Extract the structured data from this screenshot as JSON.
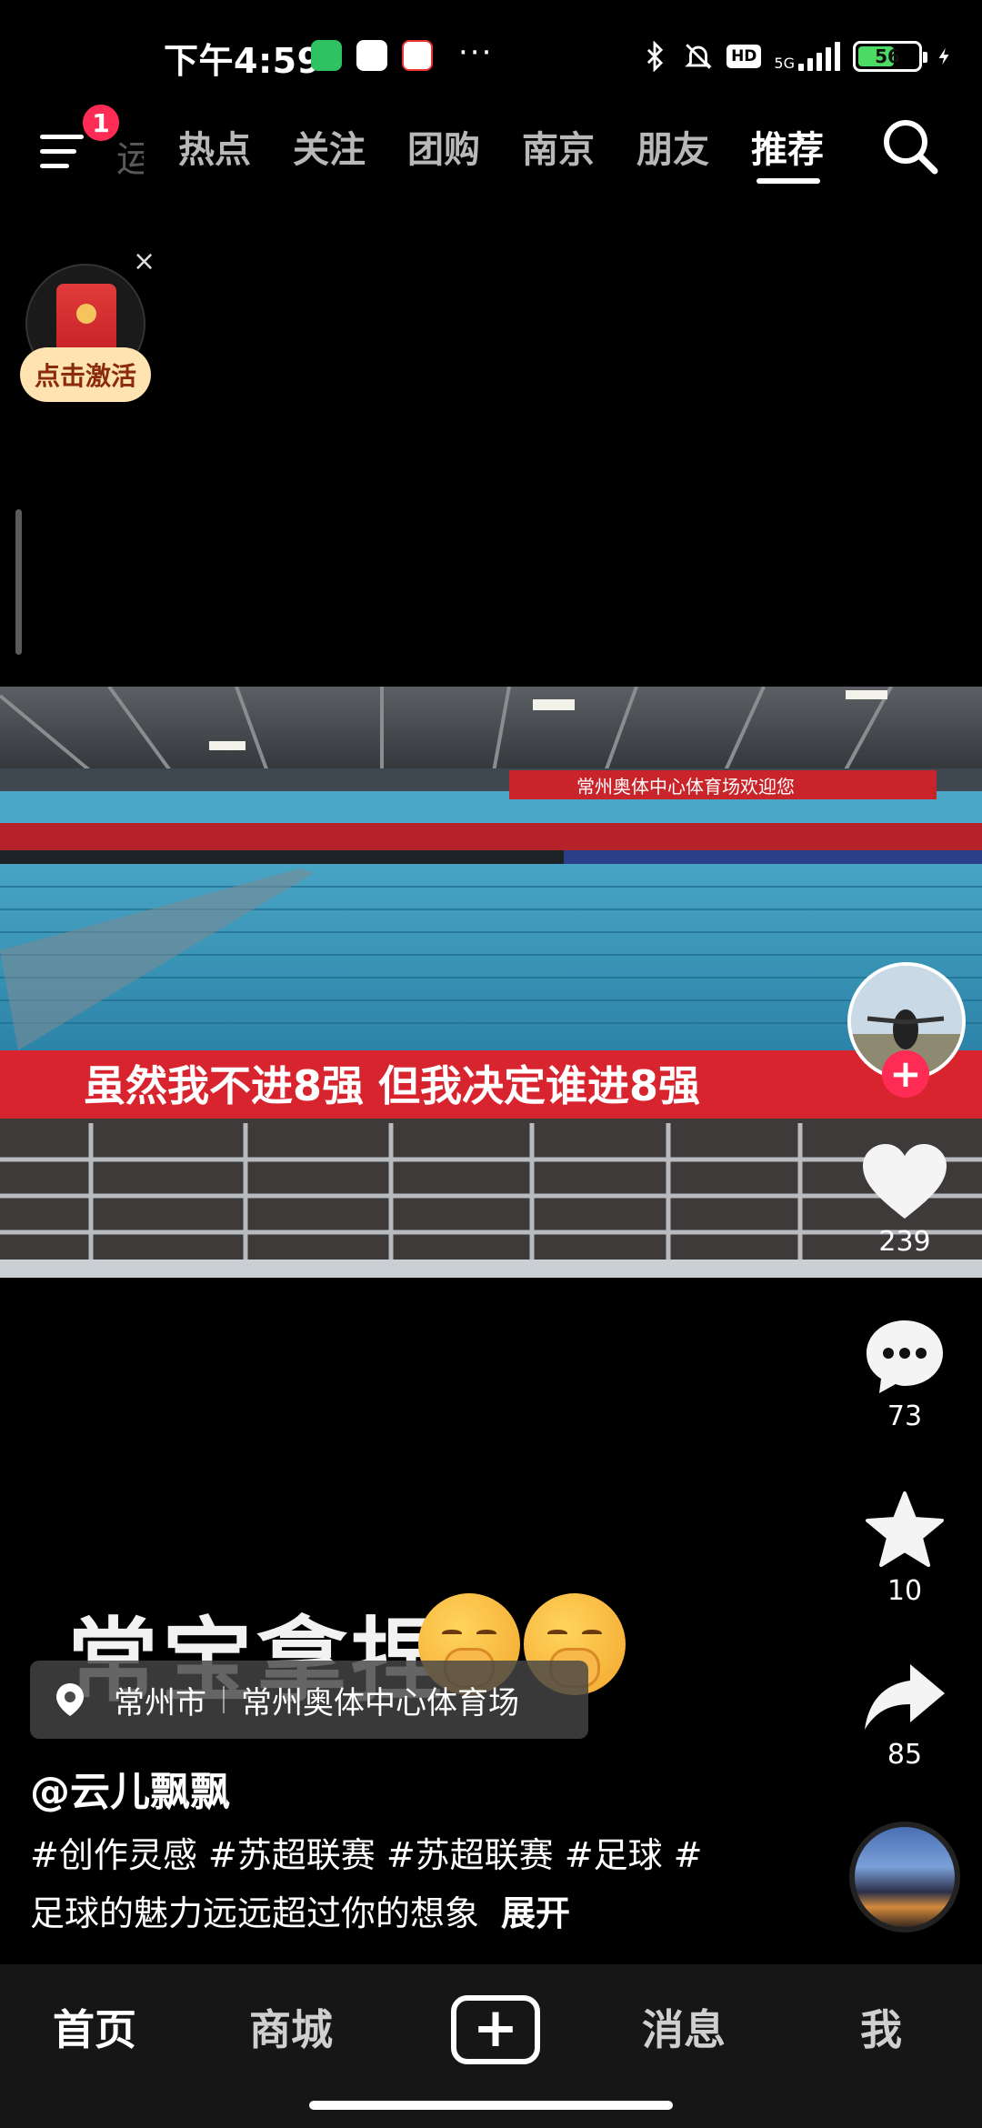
{
  "status_bar": {
    "time": "下午4:59",
    "dots": "···",
    "hd": "HD",
    "network": "5G",
    "battery": "56"
  },
  "top_nav": {
    "partial_tab": "运",
    "tabs": [
      "热点",
      "关注",
      "团购",
      "南京",
      "朋友",
      "推荐"
    ],
    "active_tab": "推荐",
    "menu_badge": "1"
  },
  "red_packet": {
    "label": "点击激活",
    "close": "×"
  },
  "video": {
    "banner_top": "常州奥体中心体育场欢迎您",
    "banner_main": "虽然我不进8强  但我决定谁进8强"
  },
  "actions": {
    "likes": "239",
    "comments": "73",
    "favorites": "10",
    "shares": "85"
  },
  "caption": {
    "big_text": "常宝拿捏"
  },
  "location": {
    "city": "常州市",
    "venue": "常州奥体中心体育场"
  },
  "post": {
    "author": "@云儿飘飘",
    "desc_line1": "#创作灵感 #苏超联赛 #苏超联赛 #足球 #",
    "desc_line2": "足球的魅力远远超过你的想象",
    "expand": "展开"
  },
  "bottom_nav": {
    "home": "首页",
    "mall": "商城",
    "messages": "消息",
    "me": "我"
  }
}
